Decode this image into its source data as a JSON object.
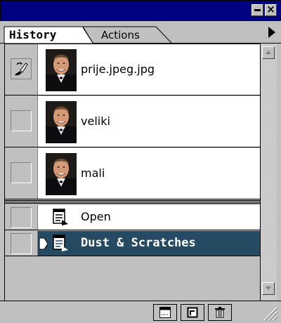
{
  "window": {
    "minimize_icon": "minimize-icon",
    "close_icon": "close-icon",
    "close_glyph": "×"
  },
  "tabs": [
    {
      "label": "History",
      "active": true
    },
    {
      "label": "Actions",
      "active": false
    }
  ],
  "palette_menu_icon": "triangle-right-icon",
  "snapshots": [
    {
      "label": "prije.jpeg.jpg",
      "history_brush_source": true
    },
    {
      "label": "veliki",
      "history_brush_source": false
    },
    {
      "label": "mali",
      "history_brush_source": false
    }
  ],
  "states": [
    {
      "label": "Open",
      "selected": false
    },
    {
      "label": "Dust & Scratches",
      "selected": true
    }
  ],
  "colors": {
    "title_bar": "#000080",
    "selected_row": "#274a63",
    "panel": "#c0c0c0"
  },
  "bottom_buttons": [
    {
      "name": "create-new-document-from-state",
      "icon": "new-document-icon"
    },
    {
      "name": "create-new-snapshot",
      "icon": "new-snapshot-icon"
    },
    {
      "name": "delete-state",
      "icon": "trash-icon"
    }
  ]
}
